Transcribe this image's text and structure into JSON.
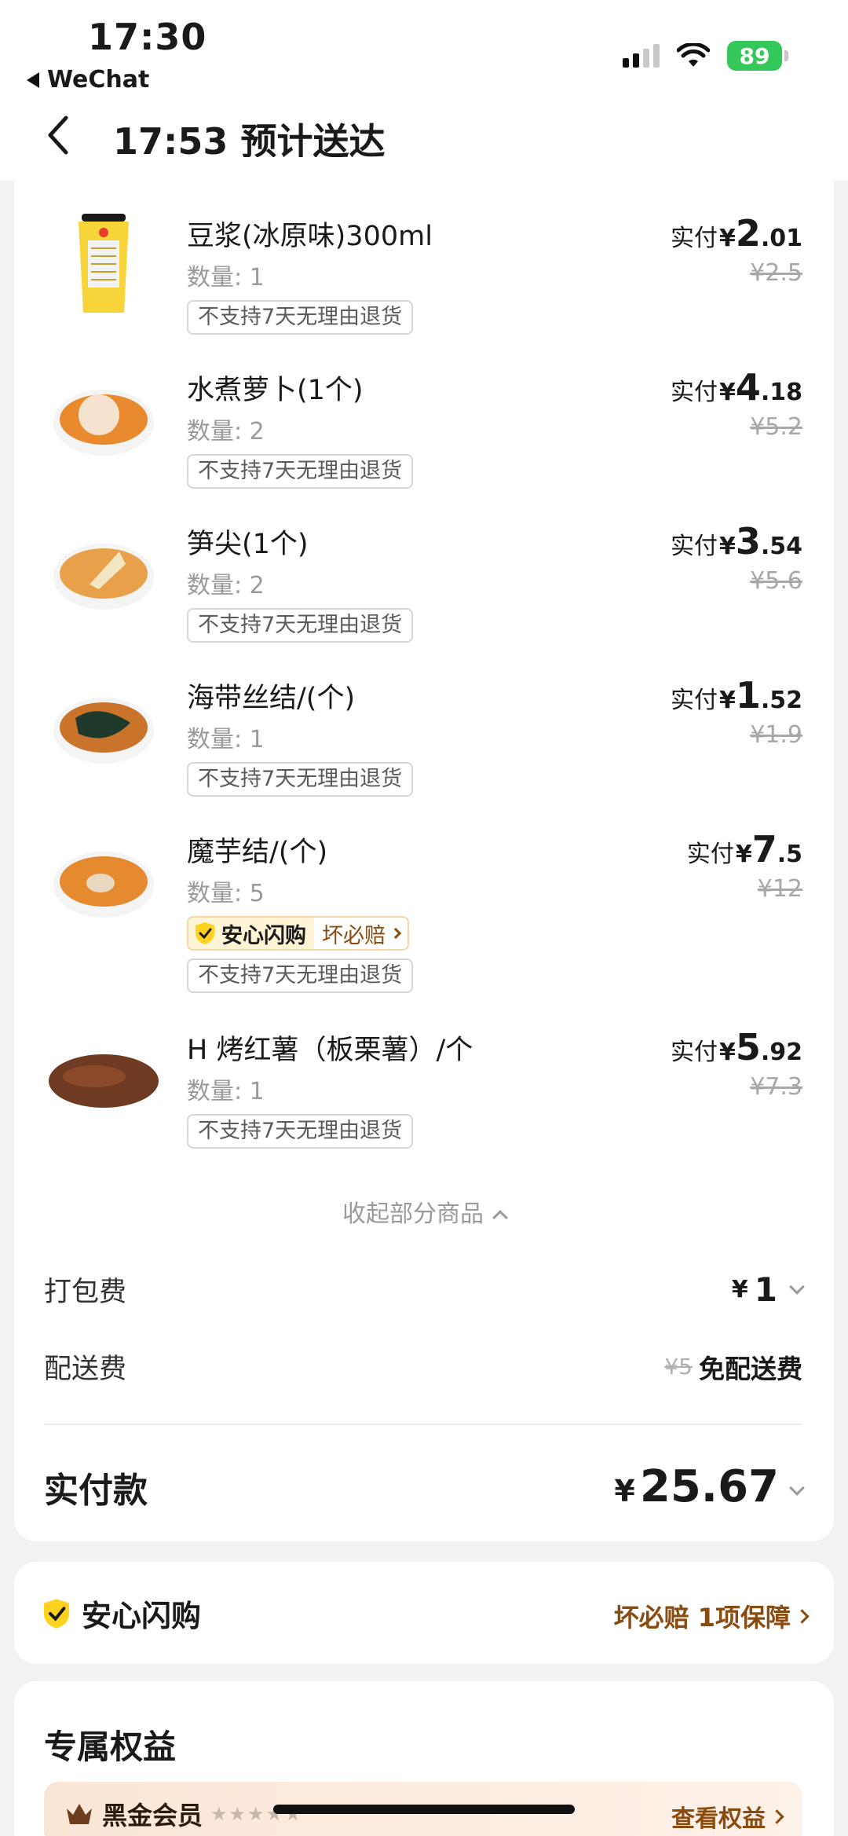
{
  "status_bar": {
    "time": "17:30",
    "back_app": "WeChat",
    "battery": "89"
  },
  "nav": {
    "title": "17:53 预计送达"
  },
  "items": [
    {
      "name": "豆浆(冰原味)300ml",
      "qty": "数量: 1",
      "tag": "不支持7天无理由退货",
      "paid_label": "实付",
      "currency": "¥",
      "price_int": "2",
      "price_dec": ".01",
      "orig_price": "¥2.5",
      "image": "soy-milk-cup"
    },
    {
      "name": "水煮萝卜(1个)",
      "qty": "数量: 2",
      "tag": "不支持7天无理由退货",
      "paid_label": "实付",
      "currency": "¥",
      "price_int": "4",
      "price_dec": ".18",
      "orig_price": "¥5.2",
      "image": "radish-bowl"
    },
    {
      "name": "笋尖(1个)",
      "qty": "数量: 2",
      "tag": "不支持7天无理由退货",
      "paid_label": "实付",
      "currency": "¥",
      "price_int": "3",
      "price_dec": ".54",
      "orig_price": "¥5.6",
      "image": "bamboo-shoot-bowl"
    },
    {
      "name": "海带丝结/(个)",
      "qty": "数量: 1",
      "tag": "不支持7天无理由退货",
      "paid_label": "实付",
      "currency": "¥",
      "price_int": "1",
      "price_dec": ".52",
      "orig_price": "¥1.9",
      "image": "kelp-bowl"
    },
    {
      "name": "魔芋结/(个)",
      "qty": "数量: 5",
      "tag": "不支持7天无理由退货",
      "paid_label": "实付",
      "currency": "¥",
      "price_int": "7",
      "price_dec": ".5",
      "orig_price": "¥12",
      "image": "konjac-bowl",
      "assure": {
        "left": "安心闪购",
        "right": "坏必赔"
      }
    },
    {
      "name": "H 烤红薯（板栗薯）/个",
      "qty": "数量: 1",
      "tag": "不支持7天无理由退货",
      "paid_label": "实付",
      "currency": "¥",
      "price_int": "5",
      "price_dec": ".92",
      "orig_price": "¥7.3",
      "image": "roasted-sweet-potato"
    }
  ],
  "collapse_label": "收起部分商品",
  "fees": {
    "packing_label": "打包费",
    "packing_currency": "¥",
    "packing_amount": "1",
    "delivery_label": "配送费",
    "delivery_orig": "¥5",
    "delivery_free": "免配送费"
  },
  "total": {
    "label": "实付款",
    "currency": "¥",
    "amount": "25.67"
  },
  "assurance": {
    "title": "安心闪购",
    "detail": "坏必赔 1项保障"
  },
  "benefits": {
    "title": "专属权益",
    "member_label": "黑金会员",
    "stars": "★★★★★",
    "link": "查看权益"
  },
  "colors": {
    "accent_brown": "#8a4b10",
    "battery_green": "#34c759",
    "shield_yellow": "#ffd21f"
  }
}
